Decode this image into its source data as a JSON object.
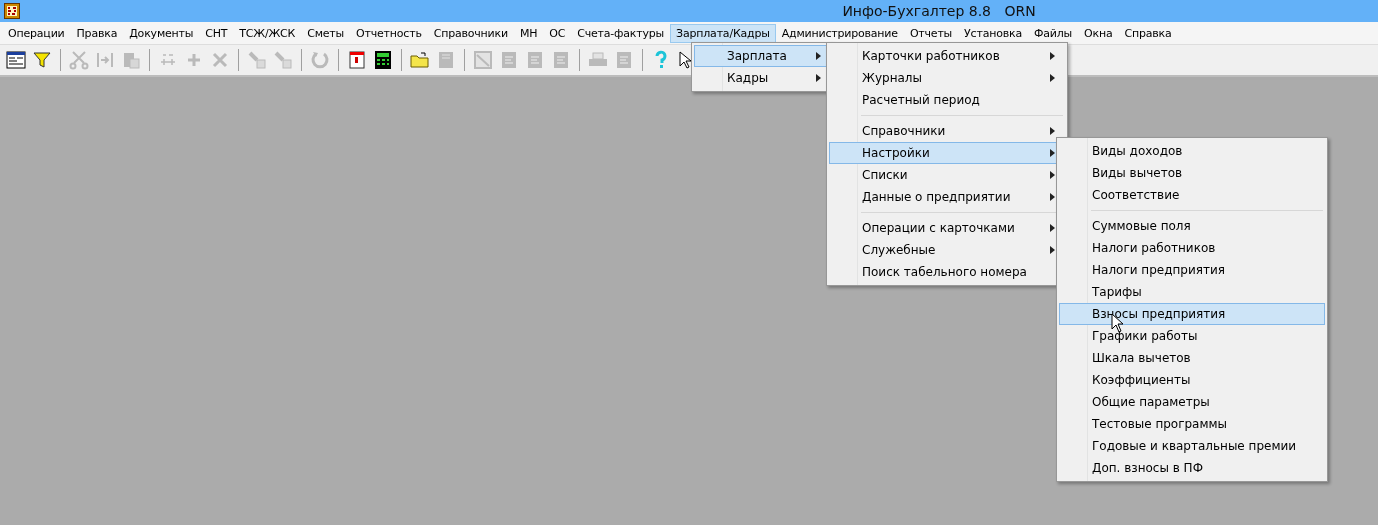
{
  "window": {
    "title": "Инфо-Бухгалтер 8.8   ORN"
  },
  "menubar": [
    {
      "label": "Операции",
      "selected": false
    },
    {
      "label": "Правка",
      "selected": false
    },
    {
      "label": "Документы",
      "selected": false
    },
    {
      "label": "СНТ",
      "selected": false
    },
    {
      "label": "ТСЖ/ЖСК",
      "selected": false
    },
    {
      "label": "Сметы",
      "selected": false
    },
    {
      "label": "Отчетность",
      "selected": false
    },
    {
      "label": "Справочники",
      "selected": false
    },
    {
      "label": "МН",
      "selected": false
    },
    {
      "label": "ОС",
      "selected": false
    },
    {
      "label": "Счета-фактуры",
      "selected": false
    },
    {
      "label": "Зарплата/Кадры",
      "selected": true
    },
    {
      "label": "Администрирование",
      "selected": false
    },
    {
      "label": "Отчеты",
      "selected": false
    },
    {
      "label": "Установка",
      "selected": false
    },
    {
      "label": "Файлы",
      "selected": false
    },
    {
      "label": "Окна",
      "selected": false
    },
    {
      "label": "Справка",
      "selected": false
    }
  ],
  "toolbar": [
    {
      "kind": "grid",
      "disabled": false
    },
    {
      "kind": "filter",
      "disabled": false
    },
    {
      "kind": "separator"
    },
    {
      "kind": "scissors",
      "disabled": true
    },
    {
      "kind": "merge",
      "disabled": true
    },
    {
      "kind": "paste",
      "disabled": true
    },
    {
      "kind": "separator"
    },
    {
      "kind": "number",
      "disabled": true
    },
    {
      "kind": "plus",
      "disabled": true
    },
    {
      "kind": "cross",
      "disabled": true
    },
    {
      "kind": "separator"
    },
    {
      "kind": "brush",
      "disabled": true
    },
    {
      "kind": "brush",
      "disabled": true
    },
    {
      "kind": "separator"
    },
    {
      "kind": "refresh",
      "disabled": true
    },
    {
      "kind": "separator"
    },
    {
      "kind": "calendar",
      "disabled": false
    },
    {
      "kind": "calculator",
      "disabled": false
    },
    {
      "kind": "separator"
    },
    {
      "kind": "folder",
      "disabled": false
    },
    {
      "kind": "save",
      "disabled": true
    },
    {
      "kind": "separator"
    },
    {
      "kind": "image",
      "disabled": true
    },
    {
      "kind": "doc",
      "disabled": true
    },
    {
      "kind": "doc",
      "disabled": true
    },
    {
      "kind": "doc",
      "disabled": true
    },
    {
      "kind": "separator"
    },
    {
      "kind": "printer",
      "disabled": true
    },
    {
      "kind": "doc",
      "disabled": true
    },
    {
      "kind": "separator"
    },
    {
      "kind": "help",
      "disabled": false
    },
    {
      "kind": "pointer",
      "disabled": false
    }
  ],
  "menus": [
    {
      "items": [
        {
          "kind": "item",
          "label": "Зарплата",
          "submenu": true,
          "selected": true
        },
        {
          "kind": "item",
          "label": "Кадры",
          "submenu": true,
          "selected": false
        }
      ]
    },
    {
      "items": [
        {
          "kind": "item",
          "label": "Карточки работников",
          "submenu": true,
          "selected": false
        },
        {
          "kind": "item",
          "label": "Журналы",
          "submenu": true,
          "selected": false
        },
        {
          "kind": "item",
          "label": "Расчетный период",
          "submenu": false,
          "selected": false
        },
        {
          "kind": "separator"
        },
        {
          "kind": "item",
          "label": "Справочники",
          "submenu": true,
          "selected": false
        },
        {
          "kind": "item",
          "label": "Настройки",
          "submenu": true,
          "selected": true
        },
        {
          "kind": "item",
          "label": "Списки",
          "submenu": true,
          "selected": false
        },
        {
          "kind": "item",
          "label": "Данные о предприятии",
          "submenu": true,
          "selected": false
        },
        {
          "kind": "separator"
        },
        {
          "kind": "item",
          "label": "Операции с карточками",
          "submenu": true,
          "selected": false
        },
        {
          "kind": "item",
          "label": "Служебные",
          "submenu": true,
          "selected": false
        },
        {
          "kind": "item",
          "label": "Поиск табельного номера",
          "submenu": false,
          "selected": false
        }
      ]
    },
    {
      "items": [
        {
          "kind": "item",
          "label": "Виды доходов",
          "submenu": false,
          "selected": false
        },
        {
          "kind": "item",
          "label": "Виды вычетов",
          "submenu": false,
          "selected": false
        },
        {
          "kind": "item",
          "label": "Соответствие",
          "submenu": false,
          "selected": false
        },
        {
          "kind": "separator"
        },
        {
          "kind": "item",
          "label": "Суммовые поля",
          "submenu": false,
          "selected": false
        },
        {
          "kind": "item",
          "label": "Налоги работников",
          "submenu": false,
          "selected": false
        },
        {
          "kind": "item",
          "label": "Налоги предприятия",
          "submenu": false,
          "selected": false
        },
        {
          "kind": "item",
          "label": "Тарифы",
          "submenu": false,
          "selected": false
        },
        {
          "kind": "item",
          "label": "Взносы предприятия",
          "submenu": false,
          "selected": true
        },
        {
          "kind": "item",
          "label": "Графики работы",
          "submenu": false,
          "selected": false
        },
        {
          "kind": "item",
          "label": "Шкала вычетов",
          "submenu": false,
          "selected": false
        },
        {
          "kind": "item",
          "label": "Коэффициенты",
          "submenu": false,
          "selected": false
        },
        {
          "kind": "item",
          "label": "Общие параметры",
          "submenu": false,
          "selected": false
        },
        {
          "kind": "item",
          "label": "Тестовые программы",
          "submenu": false,
          "selected": false
        },
        {
          "kind": "item",
          "label": "Годовые и квартальные премии",
          "submenu": false,
          "selected": false
        },
        {
          "kind": "item",
          "label": "Доп. взносы в ПФ",
          "submenu": false,
          "selected": false
        }
      ]
    }
  ]
}
